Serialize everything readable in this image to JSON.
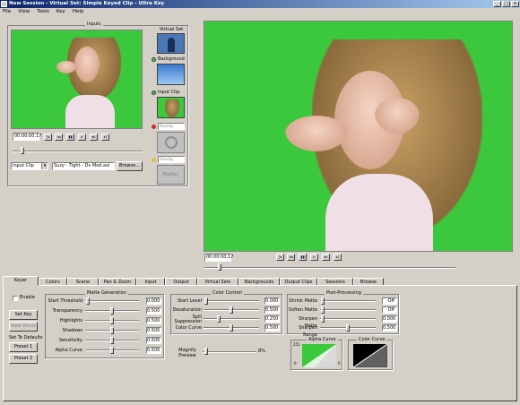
{
  "window": {
    "title": "New Session - Virtual Set: Simple Keyed Clip - Ultra Key"
  },
  "menu": [
    "File",
    "View",
    "Tools",
    "Key",
    "Help"
  ],
  "inputs": {
    "label": "Inputs",
    "timecode": "00:00:00.17",
    "source_select": "Input Clip",
    "file_path": "Suzy - Tight - Dv Mod.avi",
    "browse_label": "Browse...",
    "virtual_set_label": "Virtual Set:",
    "background_label": "Background",
    "input_clip_label": "Input Clip:",
    "overlay_label": "Overlay",
    "overlay2_label": "Overlay",
    "matte_label": "Mattes"
  },
  "output": {
    "timecode": "00:00:00.17"
  },
  "tabs": [
    "Keyer",
    "Colors",
    "Scene",
    "Pan & Zoom",
    "Input",
    "Output",
    "Virtual Sets",
    "Backgrounds",
    "Output Clips",
    "Sessions",
    "Browse"
  ],
  "keyer": {
    "enable_label": "Enable",
    "set_key_label": "Set Key",
    "view_points_label": "View Points",
    "set_defaults_label": "Set To Defaults",
    "preset1_label": "Preset 1",
    "preset2_label": "Preset 2",
    "matte_gen": {
      "title": "Matte Generation",
      "rows": [
        {
          "label": "Start Threshold",
          "value": "0.000",
          "pos": 0.02
        },
        {
          "label": "Transparency",
          "value": "0.500",
          "pos": 0.5
        },
        {
          "label": "Highlights",
          "value": "0.500",
          "pos": 0.5
        },
        {
          "label": "Shadows",
          "value": "0.500",
          "pos": 0.5
        },
        {
          "label": "Sensitivity",
          "value": "0.500",
          "pos": 0.5
        },
        {
          "label": "Alpha Curve",
          "value": "0.500",
          "pos": 0.5
        }
      ]
    },
    "color_control": {
      "title": "Color Control",
      "rows": [
        {
          "label": "Start Level",
          "value": "0.000",
          "pos": 0.02
        },
        {
          "label": "Desaturation",
          "value": "0.500",
          "pos": 0.5
        },
        {
          "label": "Spill Suppression",
          "value": "0.250",
          "pos": 0.25
        },
        {
          "label": "Color Curve",
          "value": "0.500",
          "pos": 0.5
        }
      ],
      "magnify_label": "Magnify Preview",
      "magnify_value": "8%"
    },
    "post": {
      "title": "Post-Processing",
      "rows": [
        {
          "label": "Shrink Matte",
          "value": "Off",
          "pos": 0.02
        },
        {
          "label": "Soften Matte",
          "value": "Off",
          "pos": 0.02
        },
        {
          "label": "Sharpen Matte",
          "value": "0.000",
          "pos": 0.02
        },
        {
          "label": "Sharpen Range",
          "value": "0.500",
          "pos": 0.5
        }
      ]
    },
    "alpha_curve": {
      "title": "Alpha Curve",
      "top": "255",
      "bottom": "0",
      "right": "0"
    },
    "color_curve": {
      "title": "Color Curve"
    }
  },
  "colors": {
    "green": "#3cc83c",
    "title_start": "#0a246a",
    "title_end": "#a6caf0",
    "chrome": "#d4d0c8"
  }
}
